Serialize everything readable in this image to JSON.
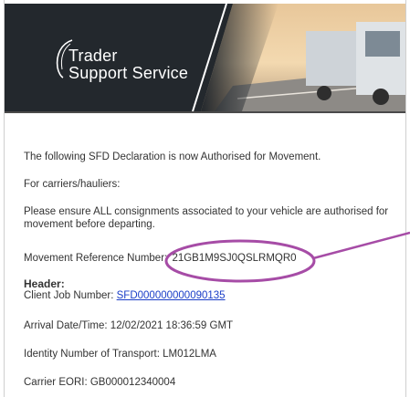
{
  "brand": {
    "line1": "Trader",
    "line2": "Support Service",
    "banner_color": "#23282d"
  },
  "email": {
    "intro": "The following SFD Declaration is now Authorised for Movement.",
    "carriers": "For carriers/hauliers:",
    "instruction": "Please ensure ALL consignments associated to your vehicle are authorised for movement before departing.",
    "mrn_label": "Movement Reference Number:",
    "mrn_value": "21GB1M9SJ0QSLRMQR0",
    "header_heading": "Header:",
    "client_job_label": "Client Job Number:",
    "client_job_value": "SFD000000000090135",
    "arrival_label": "Arrival Date/Time:",
    "arrival_value": "12/02/2021 18:36:59 GMT",
    "transport_label": "Identity Number of Transport:",
    "transport_value": "LM012LMA",
    "eori_label": "Carrier EORI:",
    "eori_value": "GB000012340004"
  },
  "annotation": {
    "color": "#a64ca6",
    "highlight_icon": "ellipse-highlight"
  }
}
